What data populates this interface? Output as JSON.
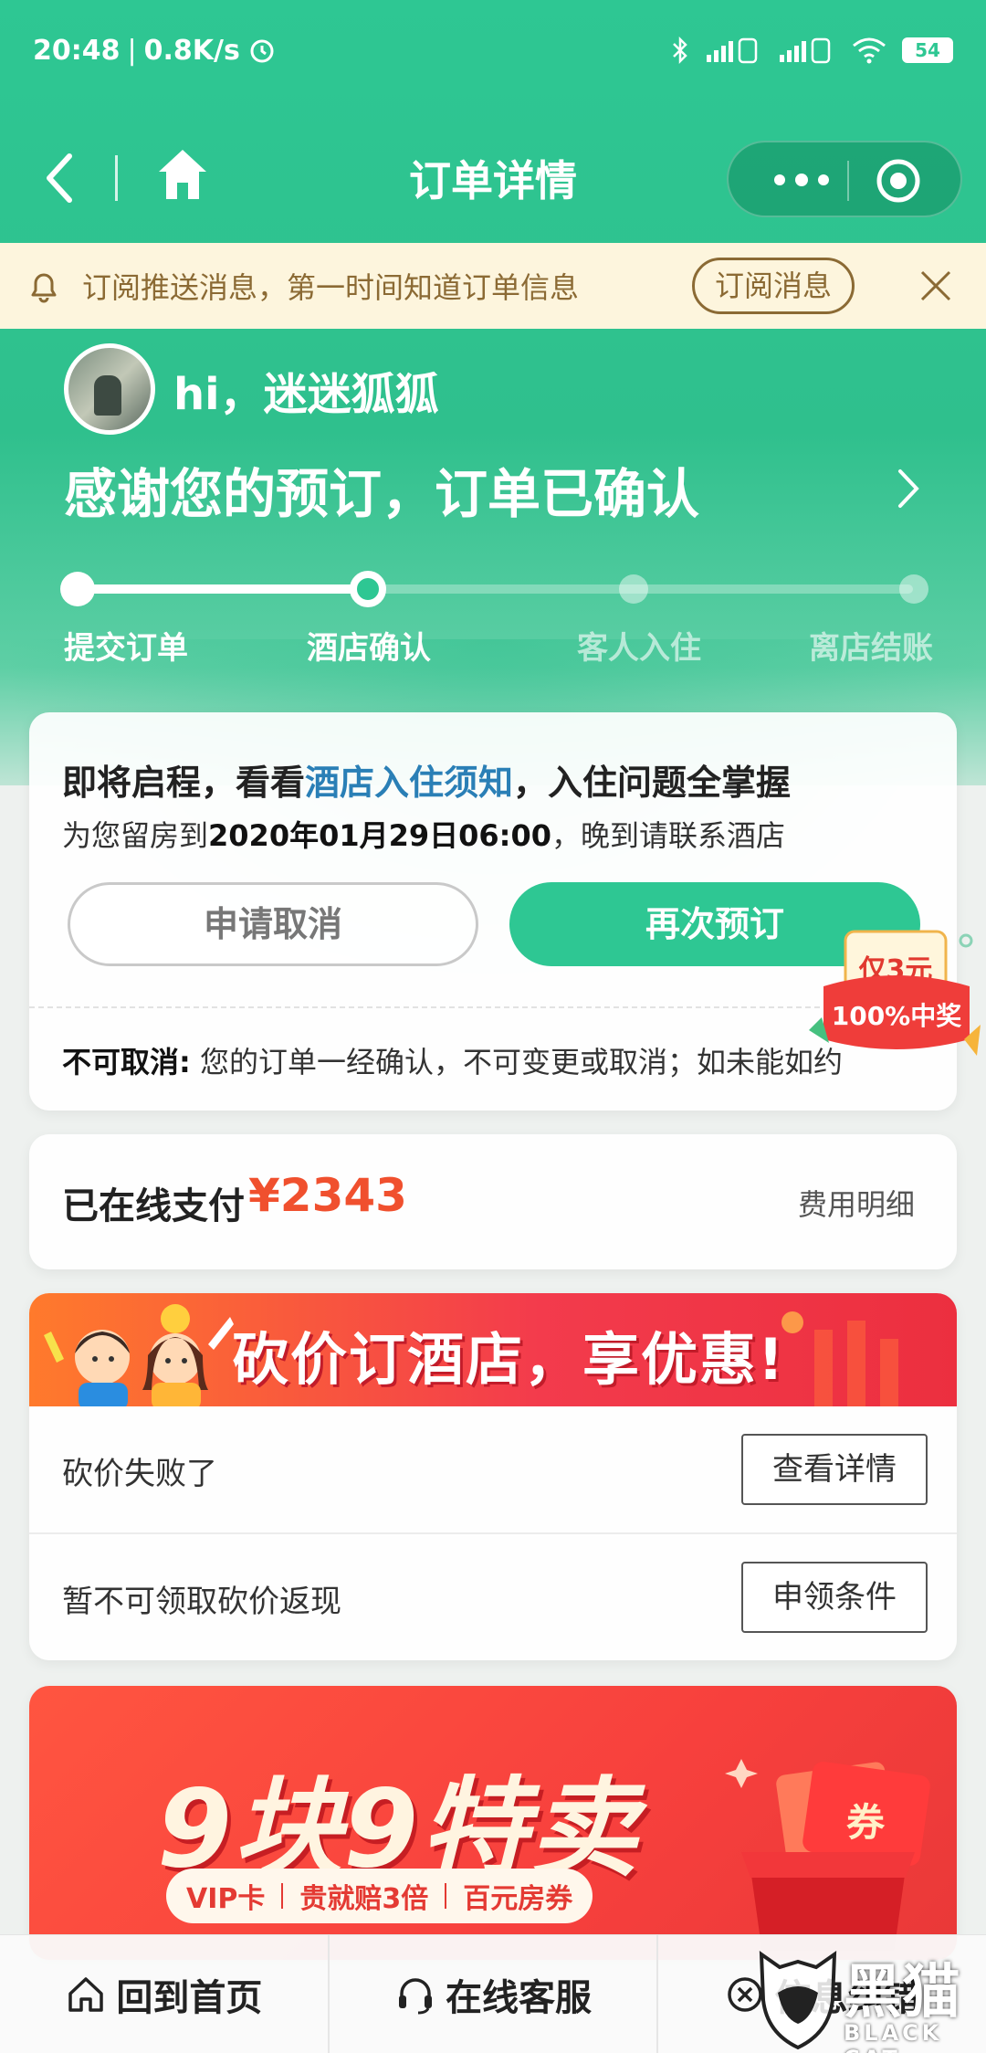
{
  "status_bar": {
    "time": "20:48",
    "speed": "0.8K/s",
    "battery": "54"
  },
  "nav": {
    "title": "订单详情"
  },
  "subscribe": {
    "text": "订阅推送消息，第一时间知道订单信息",
    "button": "订阅消息"
  },
  "greeting": {
    "hello": "hi，迷迷狐狐",
    "headline": "感谢您的预订，订单已确认"
  },
  "steps": [
    {
      "label": "提交订单",
      "state": "done"
    },
    {
      "label": "酒店确认",
      "state": "current"
    },
    {
      "label": "客人入住",
      "state": "pending"
    },
    {
      "label": "离店结账",
      "state": "pending"
    }
  ],
  "notice_card": {
    "title_prefix": "即将启程，看看",
    "title_link": "酒店入住须知",
    "title_suffix": "，入住问题全掌握",
    "hold_prefix": "为您留房到",
    "hold_time": "2020年01月29日06:00",
    "hold_suffix": "，晚到请联系酒店",
    "cancel_button": "申请取消",
    "rebook_button": "再次预订",
    "policy_label": "不可取消:",
    "policy_text": " 您的订单一经确认，不可变更或取消；如未能如约"
  },
  "promo_badge": {
    "line1": "仅3元",
    "line2": "100%中奖"
  },
  "payment": {
    "label": "已在线支付",
    "amount": "¥2343",
    "detail_link": "费用明细"
  },
  "bargain": {
    "slogan": "砍价订酒店，享优惠!",
    "rows": [
      {
        "text": "砍价失败了",
        "button": "查看详情"
      },
      {
        "text": "暂不可领取砍价返现",
        "button": "申领条件"
      }
    ]
  },
  "flash_sale": {
    "title": "9块9特卖",
    "chips": [
      "VIP卡",
      "贵就赔3倍",
      "百元房券"
    ],
    "gift_label": "券"
  },
  "bottom_nav": {
    "home": "回到首页",
    "service": "在线客服",
    "report": "信息纠错"
  },
  "watermark": {
    "cn": "黑猫",
    "en": "BLACK CAT"
  },
  "colors": {
    "brand_green": "#2ec793",
    "price_red": "#f0502e",
    "link_blue": "#2a7fb6",
    "banner_text": "#8b6a34"
  }
}
